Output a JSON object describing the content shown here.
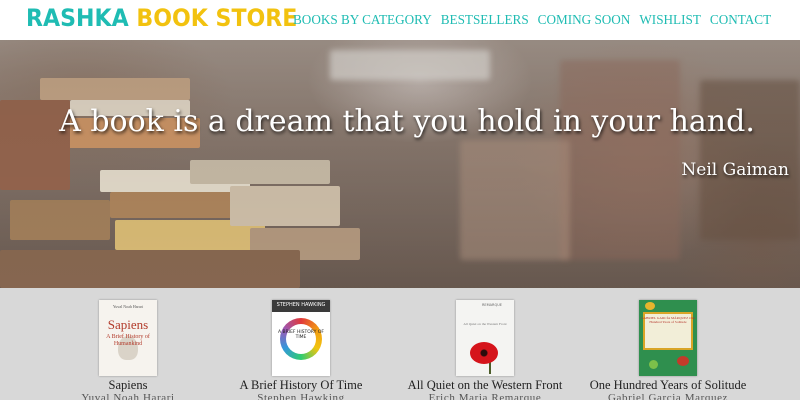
{
  "header": {
    "logo_part1": "RASHKA",
    "logo_part2": "BOOK STORE",
    "nav": [
      {
        "label": "BOOKS BY CATEGORY"
      },
      {
        "label": "BESTSELLERS"
      },
      {
        "label": "COMING SOON"
      },
      {
        "label": "WISHLIST"
      },
      {
        "label": "CONTACT"
      }
    ]
  },
  "hero": {
    "quote": "A book is a dream that you hold in your hand.",
    "author": "Neil Gaiman"
  },
  "books": [
    {
      "title": "Sapiens",
      "author": "Yuval Noah Harari",
      "cover": {
        "top_line": "Yuval Noah Harari",
        "main": "Sapiens",
        "sub": "A Brief History of Humankind"
      }
    },
    {
      "title": "A Brief History Of Time",
      "author": "Stephen Hawking",
      "cover": {
        "top_line": "STEPHEN HAWKING",
        "main": "A BRIEF HISTORY OF TIME"
      }
    },
    {
      "title": "All Quiet on the Western Front",
      "author": "Erich Maria Remarque",
      "cover": {
        "top_line": "REMARQUE",
        "main": "All Quiet on the Western Front"
      }
    },
    {
      "title": "One Hundred Years of Solitude",
      "author": "Gabriel Garcia Marquez",
      "cover": {
        "main": "GABRIEL GARCÍA MÁRQUEZ One Hundred Years of Solitude"
      }
    }
  ],
  "colors": {
    "brand_teal": "#1fbcb3",
    "brand_yellow": "#f2c20f",
    "strip_background": "#d8d8d8"
  }
}
